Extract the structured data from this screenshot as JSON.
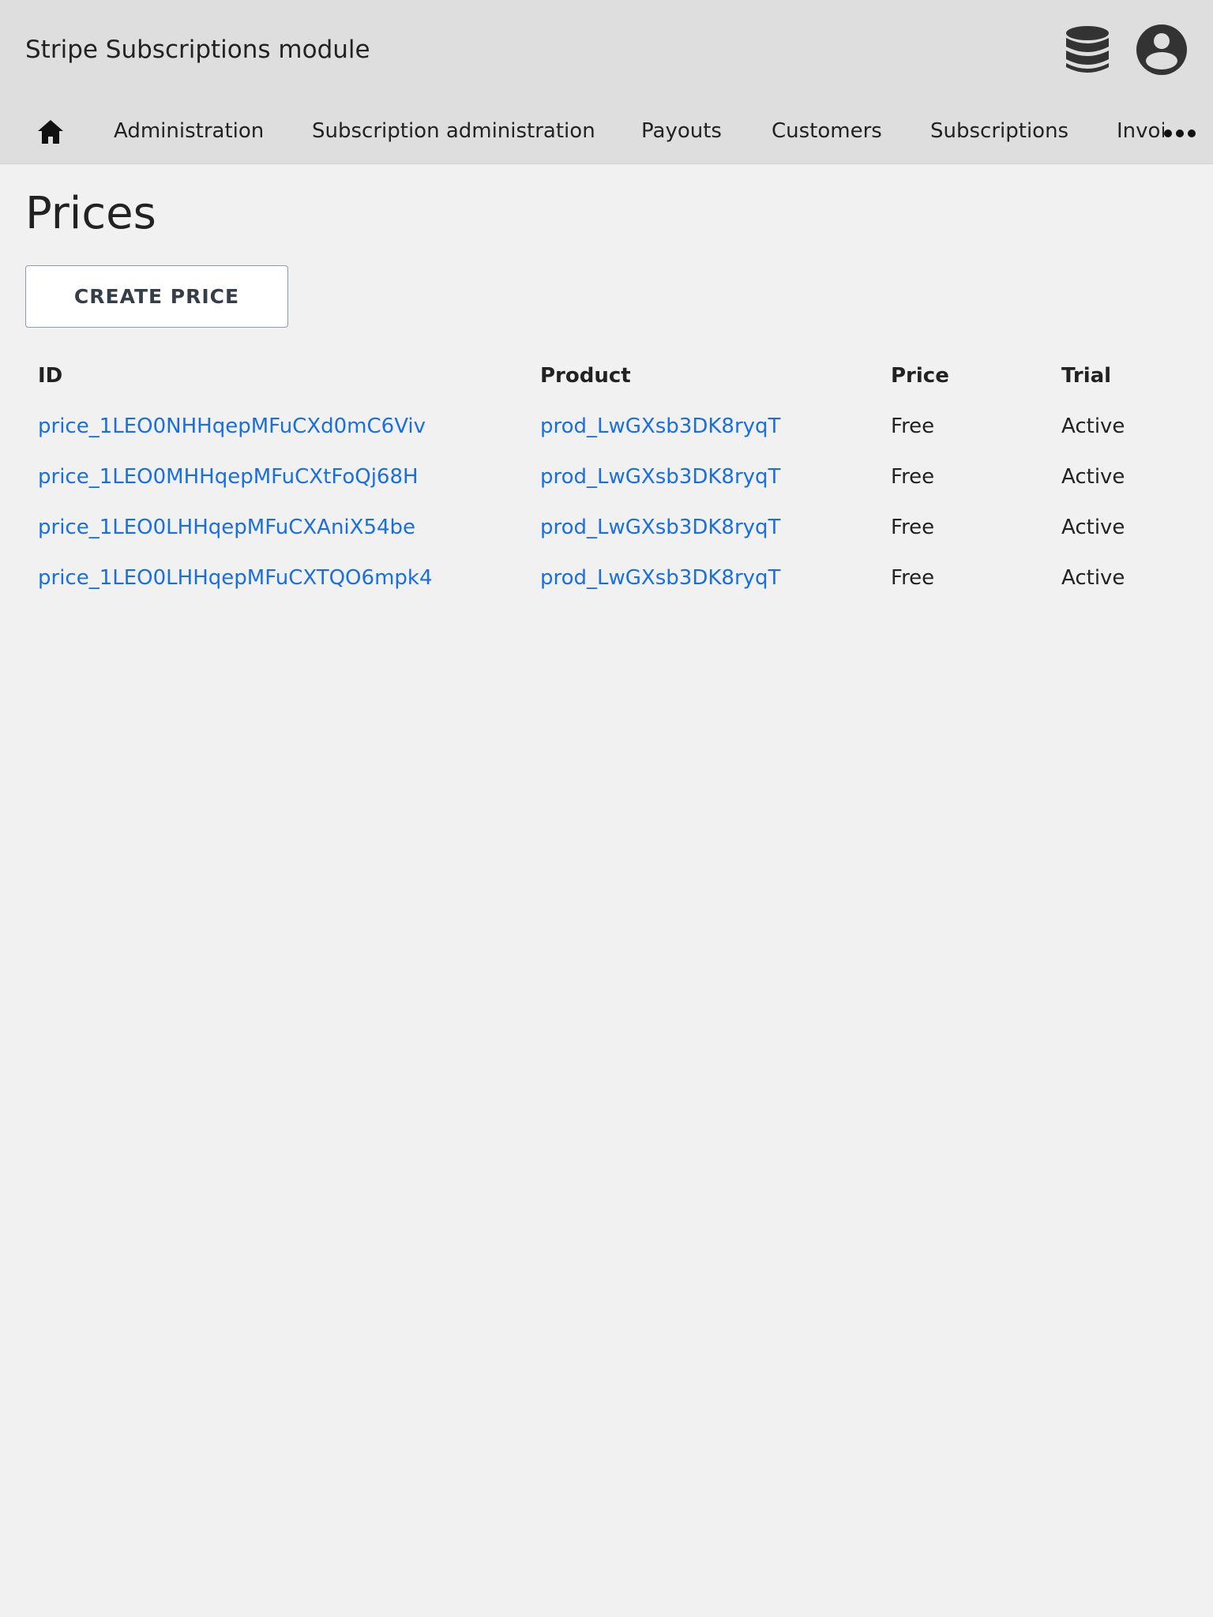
{
  "header": {
    "app_title": "Stripe Subscriptions module",
    "icons": [
      "database-icon",
      "user-account-icon"
    ]
  },
  "nav": {
    "home_icon": "home-icon",
    "items": [
      {
        "label": "Administration"
      },
      {
        "label": "Subscription administration"
      },
      {
        "label": "Payouts"
      },
      {
        "label": "Customers"
      },
      {
        "label": "Subscriptions"
      },
      {
        "label": "Invoices"
      }
    ],
    "more_icon": "more-horizontal-icon"
  },
  "main": {
    "title": "Prices",
    "create_button_label": "CREATE PRICE",
    "table": {
      "columns": [
        "ID",
        "Product",
        "Price",
        "Trial"
      ],
      "rows": [
        {
          "id": "price_1LEO0NHHqepMFuCXd0mC6Viv",
          "product": "prod_LwGXsb3DK8ryqT",
          "price": "Free",
          "trial": "Active"
        },
        {
          "id": "price_1LEO0MHHqepMFuCXtFoQj68H",
          "product": "prod_LwGXsb3DK8ryqT",
          "price": "Free",
          "trial": "Active"
        },
        {
          "id": "price_1LEO0LHHqepMFuCXAniX54be",
          "product": "prod_LwGXsb3DK8ryqT",
          "price": "Free",
          "trial": "Active"
        },
        {
          "id": "price_1LEO0LHHqepMFuCXTQO6mpk4",
          "product": "prod_LwGXsb3DK8ryqT",
          "price": "Free",
          "trial": "Active"
        }
      ]
    }
  },
  "colors": {
    "header_bg": "#dedede",
    "page_bg": "#f1f1f1",
    "link": "#1a6fe0",
    "icon": "#333333"
  }
}
